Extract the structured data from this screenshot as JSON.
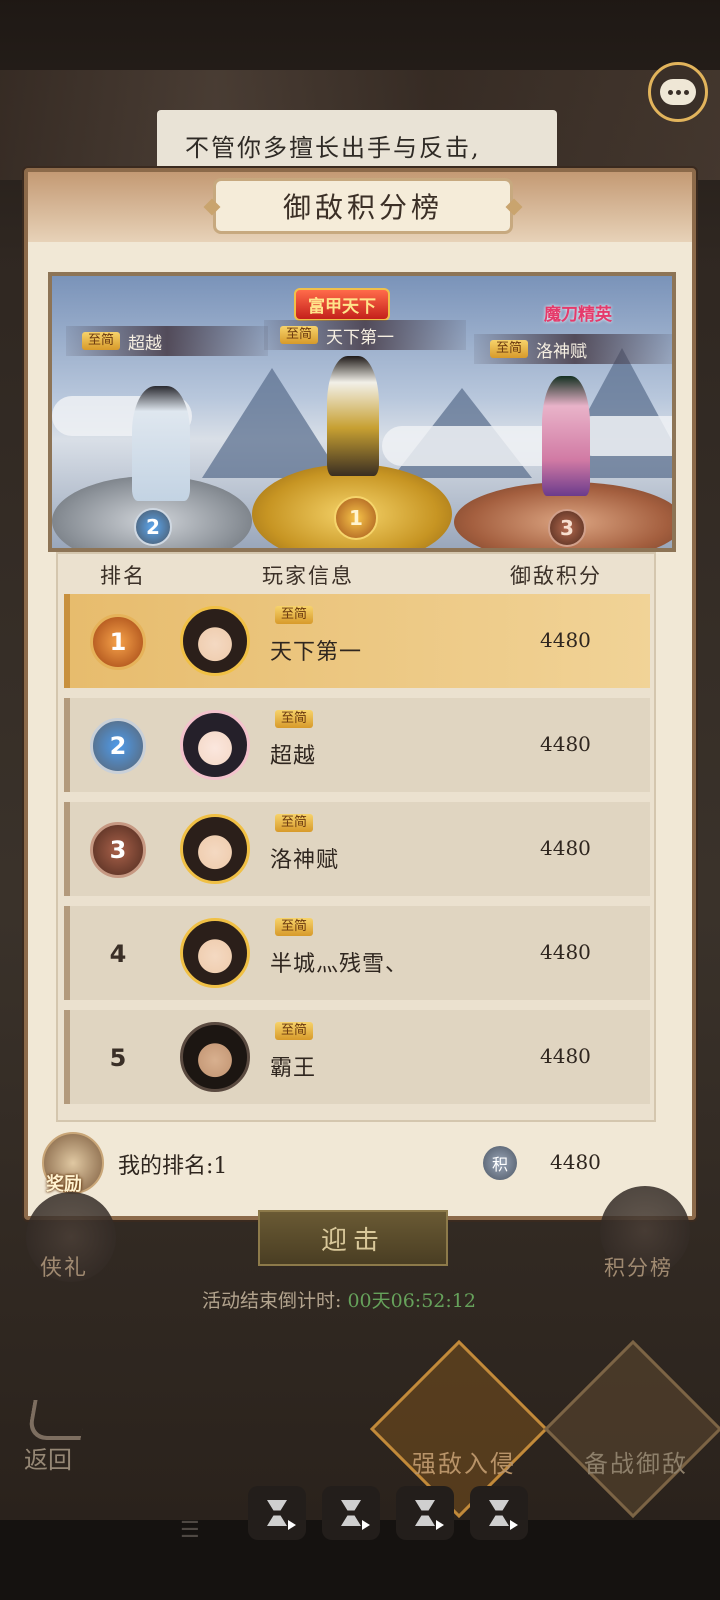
{
  "dialog": {
    "text": "不管你多擅长出手与反击,"
  },
  "panel": {
    "title": "御敌积分榜"
  },
  "podium": {
    "first": {
      "title_badge": "富甲天下",
      "tag": "至简",
      "name": "天下第一",
      "rank": "1"
    },
    "second": {
      "tag": "至简",
      "name": "超越",
      "rank": "2"
    },
    "third": {
      "title_badge": "魔刀精英",
      "tag": "至简",
      "name": "洛神赋",
      "rank": "3"
    }
  },
  "table": {
    "headers": {
      "rank": "排名",
      "player": "玩家信息",
      "score": "御敌积分"
    },
    "rows": [
      {
        "rank": "1",
        "tag": "至简",
        "name": "天下第一",
        "score": "4480"
      },
      {
        "rank": "2",
        "tag": "至简",
        "name": "超越",
        "score": "4480"
      },
      {
        "rank": "3",
        "tag": "至简",
        "name": "洛神赋",
        "score": "4480"
      },
      {
        "rank": "4",
        "tag": "至简",
        "name": "半城灬残雪、",
        "score": "4480"
      },
      {
        "rank": "5",
        "tag": "至简",
        "name": "霸王",
        "score": "4480"
      }
    ]
  },
  "my_rank": {
    "reward_label": "奖励",
    "label": "我的排名:1",
    "coin_glyph": "积",
    "score": "4480"
  },
  "bottom": {
    "engage_label": "迎击",
    "left_label": "侠礼",
    "right_label": "积分榜",
    "countdown_label": "活动结束倒计时: ",
    "countdown_value": "00天06:52:12",
    "back_label": "返回",
    "invade_label": "强敌入侵",
    "prepare_label": "备战御敌"
  }
}
